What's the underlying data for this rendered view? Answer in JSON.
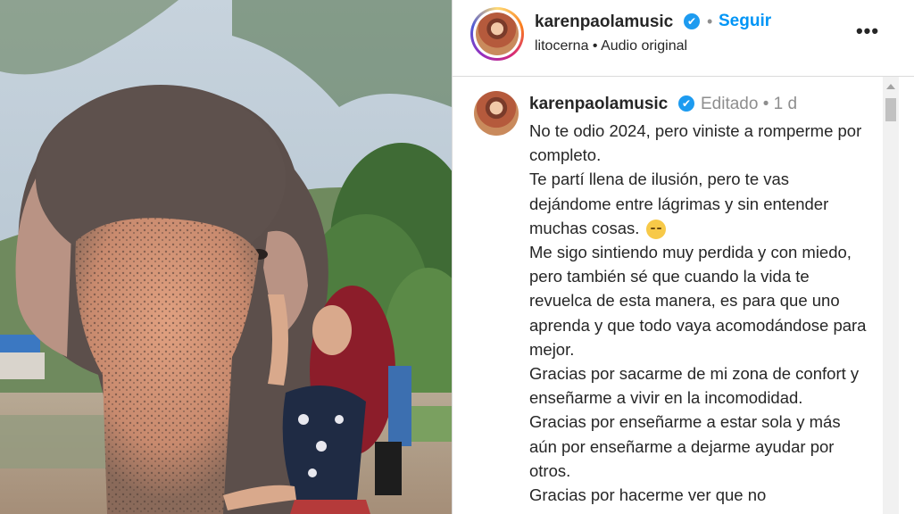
{
  "header": {
    "username": "karenpaolamusic",
    "verified_mark": "✔",
    "separator": "•",
    "follow_label": "Seguir",
    "audio_line": "litocerna • Audio original",
    "more_label": "•••"
  },
  "caption": {
    "username": "karenpaolamusic",
    "verified_mark": "✔",
    "meta": "Editado • 1 d",
    "paragraphs": [
      "No te odio 2024, pero viniste a romperme por completo.",
      "Te partí llena de ilusión, pero te vas dejándome entre lágrimas y sin entender muchas cosas.",
      "Me sigo sintiendo muy perdida y con miedo, pero también sé que cuando la vida te revuelca de esta manera, es para que uno aprenda y que todo vaya acomodándose para mejor.",
      "Gracias por sacarme de mi zona de confort y enseñarme a vivir en la incomodidad.",
      "Gracias por enseñarme a estar sola y más aún por enseñarme a dejarme ayudar por otros.",
      "Gracias por hacerme ver que no"
    ],
    "emoji": "pensive-face"
  },
  "icons": {
    "verified": "verified-badge-icon",
    "more": "more-options-icon",
    "scroll_up": "scroll-up-arrow-icon"
  },
  "colors": {
    "follow": "#0095f6",
    "verified": "#1d9bf0",
    "meta_gray": "#8e8e8e"
  }
}
